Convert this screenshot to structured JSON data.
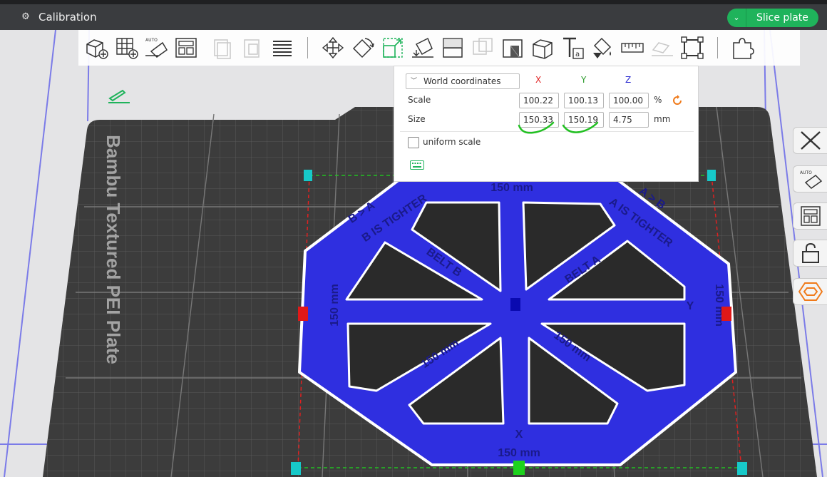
{
  "window": {
    "title": "Calibration",
    "slice_label": "Slice plate"
  },
  "bed_label": "Bambu Textured PEI Plate",
  "model": {
    "dimension_label": "150 mm",
    "text_b_is_tighter": "B IS TIGHTER",
    "text_a_is_tighter": "A IS TIGHTER",
    "text_belt_a": "BELT A",
    "text_belt_b": "BELT B",
    "text_b_gt_a": "B > A",
    "text_a_gt_b": "A > B",
    "axis_x": "X",
    "axis_y": "Y"
  },
  "scale_panel": {
    "coord_mode": "World coordinates",
    "axes": [
      "X",
      "Y",
      "Z"
    ],
    "scale_label": "Scale",
    "size_label": "Size",
    "scale": {
      "x": "100.22",
      "y": "100.13",
      "z": "100.00",
      "unit": "%"
    },
    "size": {
      "x": "150.33",
      "y": "150.19",
      "z": "4.75",
      "unit": "mm"
    },
    "uniform_scale_label": "uniform scale",
    "uniform_scale_checked": false
  },
  "colors": {
    "accent_green": "#1fb35b",
    "model_blue": "#2f2fe0",
    "axis_x": "#e02020",
    "axis_y": "#2a9a2a",
    "axis_z": "#2b2bd0",
    "reset_orange": "#f07a1a"
  },
  "toolbar_icons": [
    "add-object-icon",
    "add-plate-icon",
    "auto-orient-icon",
    "arrange-icon",
    "copy-icon",
    "paste-icon",
    "layers-icon",
    "move-icon",
    "rotate-icon",
    "scale-icon",
    "lay-on-face-icon",
    "split-icon",
    "split-parts-icon",
    "cut-icon",
    "support-paint-icon",
    "text-icon",
    "color-paint-icon",
    "measure-icon",
    "assembly-icon",
    "fit-view-icon",
    "puzzle-icon"
  ],
  "right_icons": [
    "close-icon",
    "auto-orient-icon",
    "arrange-icon",
    "lock-icon",
    "hexagon-icon"
  ]
}
